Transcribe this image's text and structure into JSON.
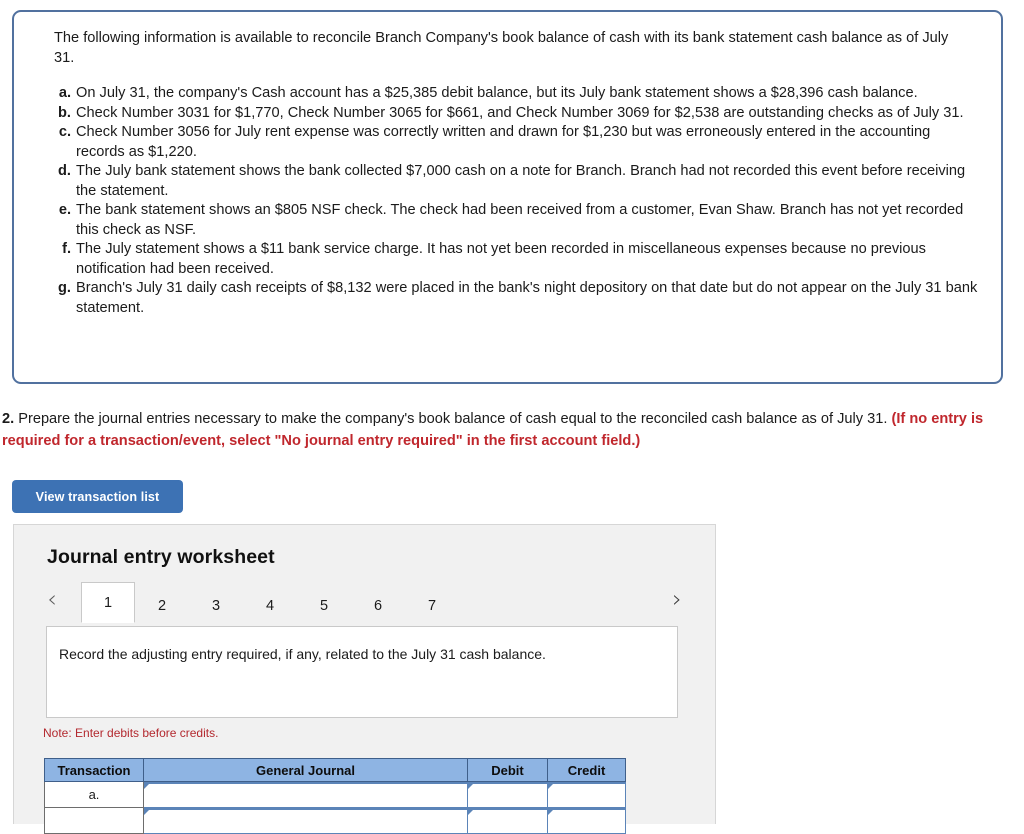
{
  "info_panel": {
    "intro": "The following information is available to reconcile Branch Company's book balance of cash with its bank statement cash balance as of July 31.",
    "facts": [
      {
        "marker": "a.",
        "text": "On July 31, the company's Cash account has a $25,385 debit balance, but its July bank statement shows a $28,396 cash balance."
      },
      {
        "marker": "b.",
        "text": "Check Number 3031 for $1,770, Check Number 3065 for $661, and Check Number 3069 for $2,538 are outstanding checks as of July 31."
      },
      {
        "marker": "c.",
        "text": "Check Number 3056 for July rent expense was correctly written and drawn for $1,230 but was erroneously entered in the accounting records as $1,220."
      },
      {
        "marker": "d.",
        "text": "The July bank statement shows the bank collected $7,000 cash on a note for Branch. Branch had not recorded this event before receiving the statement."
      },
      {
        "marker": "e.",
        "text": "The bank statement shows an $805 NSF check. The check had been received from a customer, Evan Shaw. Branch has not yet recorded this check as NSF."
      },
      {
        "marker": "f.",
        "text": "The July statement shows a $11 bank service charge. It has not yet been recorded in miscellaneous expenses because no previous notification had been received."
      },
      {
        "marker": "g.",
        "text": "Branch's July 31 daily cash receipts of $8,132 were placed in the bank's night depository on that date but do not appear on the July 31 bank statement."
      }
    ]
  },
  "question2": {
    "number": "2.",
    "text": "Prepare the journal entries necessary to make the company's book balance of cash equal to the reconciled cash balance as of July 31.",
    "red_note": "(If no entry is required for a transaction/event, select \"No journal entry required\" in the first account field.)"
  },
  "toolbar": {
    "view_transaction_list_label": "View transaction list"
  },
  "worksheet": {
    "title": "Journal entry worksheet",
    "prev_icon": "chevron-left-icon",
    "next_icon": "chevron-right-icon",
    "tabs": [
      "1",
      "2",
      "3",
      "4",
      "5",
      "6",
      "7"
    ],
    "active_tab": "1",
    "instruction": "Record the adjusting entry required, if any, related to the July 31 cash balance.",
    "note": "Note: Enter debits before credits.",
    "table": {
      "columns": [
        "Transaction",
        "General Journal",
        "Debit",
        "Credit"
      ],
      "rows": [
        {
          "transaction": "a.",
          "general_journal": "",
          "debit": "",
          "credit": ""
        },
        {
          "transaction": "",
          "general_journal": "",
          "debit": "",
          "credit": ""
        }
      ]
    }
  },
  "colors": {
    "panel_border": "#51719f",
    "button_blue": "#3d72b4",
    "red_text": "#c0272d",
    "table_header_blue": "#8eb4e3",
    "note_red": "#b3292f"
  }
}
